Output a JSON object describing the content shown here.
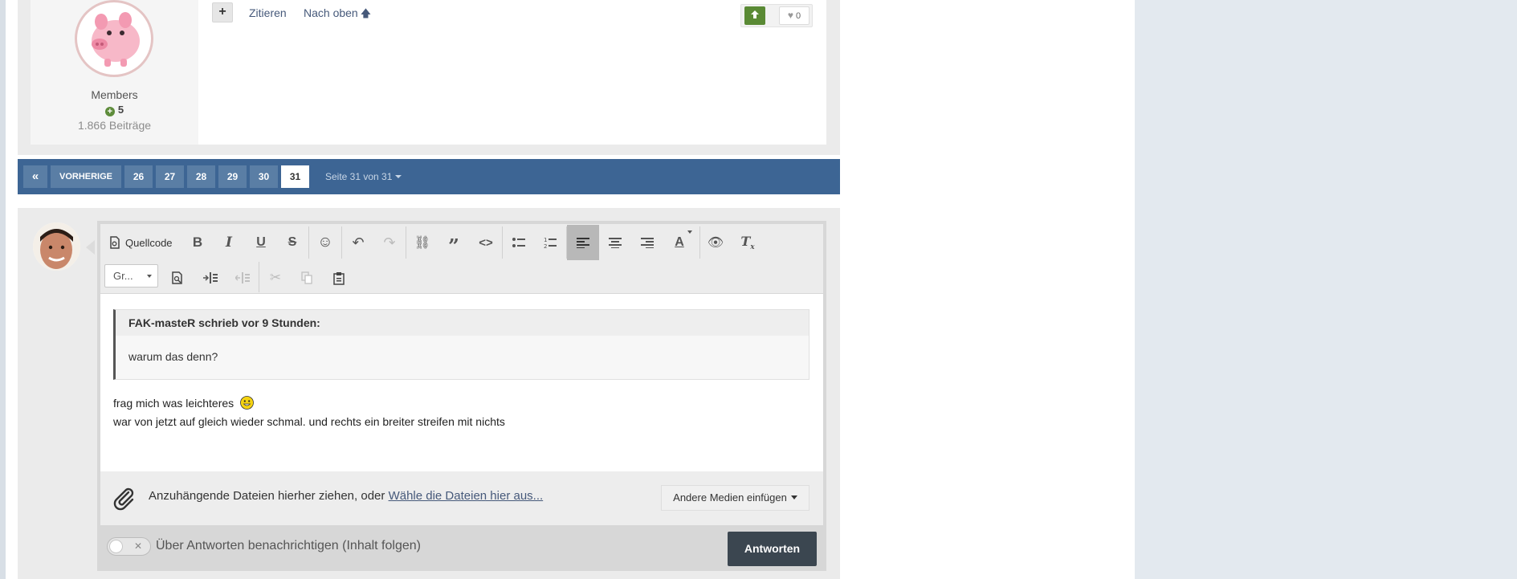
{
  "post": {
    "author": {
      "group": "Members",
      "reputation": "5",
      "post_count": "1.866 Beiträge"
    },
    "actions": {
      "quote_label": "Zitieren",
      "top_label": "Nach oben",
      "like_count": "0"
    }
  },
  "pagination": {
    "prev_label": "VORHERIGE",
    "pages": [
      "26",
      "27",
      "28",
      "29",
      "30",
      "31"
    ],
    "current": "31",
    "page_info": "Seite 31 von 31"
  },
  "editor": {
    "toolbar": {
      "source_label": "Quellcode",
      "font_size_value": "Gr..."
    },
    "quote": {
      "citation": "FAK-masteR schrieb vor 9 Stunden:",
      "text": "warum das denn?"
    },
    "body_lines": [
      "frag mich was leichteres",
      "war von jetzt auf gleich wieder schmal. und rechts ein breiter streifen mit nichts"
    ]
  },
  "attachments": {
    "text": "Anzuhängende Dateien hierher ziehen, oder",
    "link": "Wähle die Dateien hier aus...",
    "media_button": "Andere Medien einfügen"
  },
  "reply_footer": {
    "follow_label": "Über Antworten benachrichtigen (Inhalt folgen)",
    "submit_label": "Antworten"
  },
  "colors": {
    "pagination_bg": "#3d6594",
    "reputation_green": "#5e8c3b",
    "submit_button": "#3b4650",
    "link": "#46597a"
  },
  "icons": {
    "first_page": "double-chevron-left-icon",
    "like": "heart-icon",
    "upvote": "arrow-up-icon",
    "attach": "paperclip-icon"
  }
}
